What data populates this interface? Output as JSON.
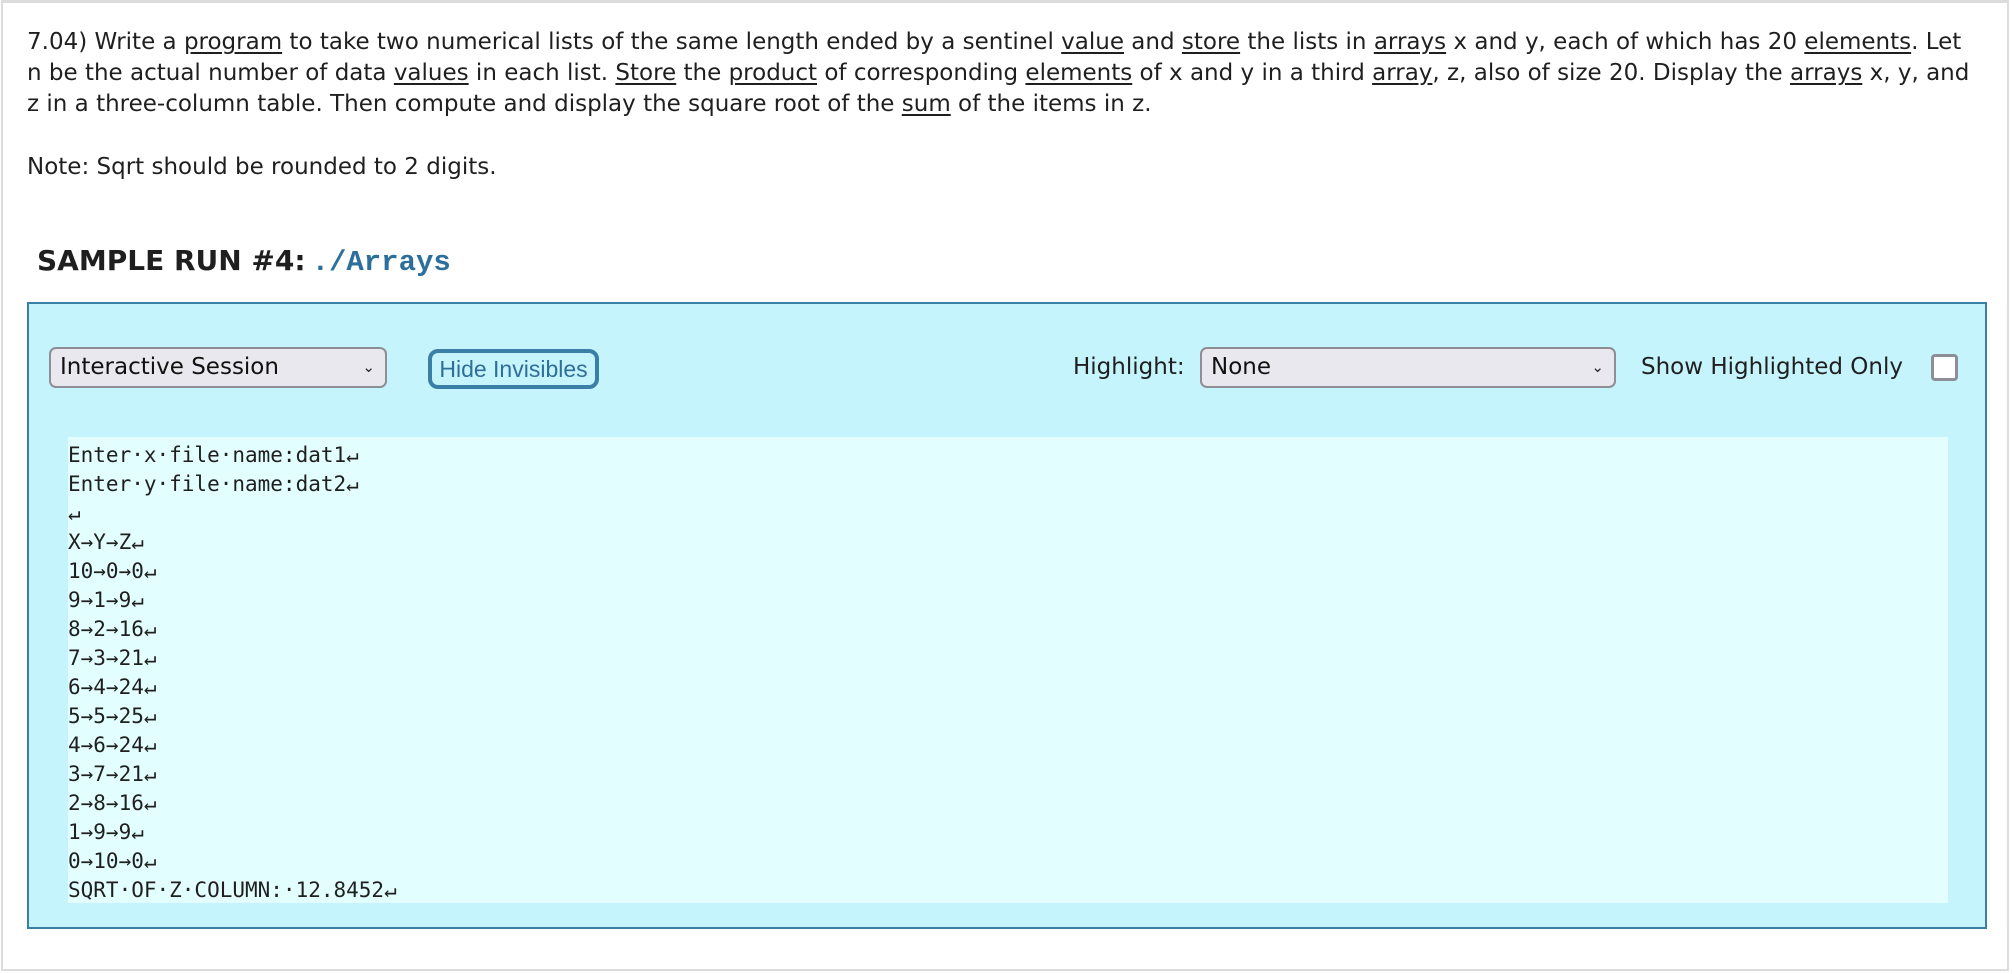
{
  "problem": {
    "segments": [
      {
        "t": "7.04) Write a "
      },
      {
        "t": "program",
        "u": true
      },
      {
        "t": " to take two numerical lists of the same length ended by a sentinel "
      },
      {
        "t": "value",
        "u": true
      },
      {
        "t": " and "
      },
      {
        "t": "store",
        "u": true
      },
      {
        "t": " the lists in "
      },
      {
        "t": "arrays",
        "u": true
      },
      {
        "t": " x and y, each of which has 20 "
      },
      {
        "t": "elements",
        "u": true
      },
      {
        "t": ". Let n be the actual number of data "
      },
      {
        "t": "values",
        "u": true
      },
      {
        "t": " in each list. "
      },
      {
        "t": "Store",
        "u": true
      },
      {
        "t": " the "
      },
      {
        "t": "product",
        "u": true
      },
      {
        "t": " of corresponding "
      },
      {
        "t": "elements",
        "u": true
      },
      {
        "t": " of x and y in a third "
      },
      {
        "t": "array",
        "u": true
      },
      {
        "t": ", z, also of size 20. Display the "
      },
      {
        "t": "arrays",
        "u": true
      },
      {
        "t": " x, y, and z in a three-column table. Then compute and display the square root of the "
      },
      {
        "t": "sum",
        "u": true
      },
      {
        "t": " of the items in z."
      }
    ],
    "note": "Note: Sqrt should be rounded to 2 digits."
  },
  "sample_run": {
    "heading": "SAMPLE RUN #4:",
    "command": "./Arrays"
  },
  "toolbar": {
    "mode_select": {
      "selected": "Interactive Session",
      "chevron": "⌄"
    },
    "hide_invisibles_label": "Hide Invisibles",
    "highlight_label": "Highlight:",
    "highlight_select": {
      "selected": "None",
      "chevron": "⌄"
    },
    "show_highlighted_only_label": "Show Highlighted Only",
    "show_highlighted_only_checked": false
  },
  "output_lines": [
    "Enter·x·file·name:dat1↵",
    "Enter·y·file·name:dat2↵",
    "↵",
    "X→Y→Z↵",
    "10→0→0↵",
    "9→1→9↵",
    "8→2→16↵",
    "7→3→21↵",
    "6→4→24↵",
    "5→5→25↵",
    "4→6→24↵",
    "3→7→21↵",
    "2→8→16↵",
    "1→9→9↵",
    "0→10→0↵",
    "SQRT·OF·Z·COLUMN:·12.8452↵"
  ],
  "colors": {
    "run_box_bg": "#c5f4fc",
    "run_box_border": "#3a7fa6",
    "output_bg": "#e2fefe",
    "command_color": "#2d6f9c"
  }
}
